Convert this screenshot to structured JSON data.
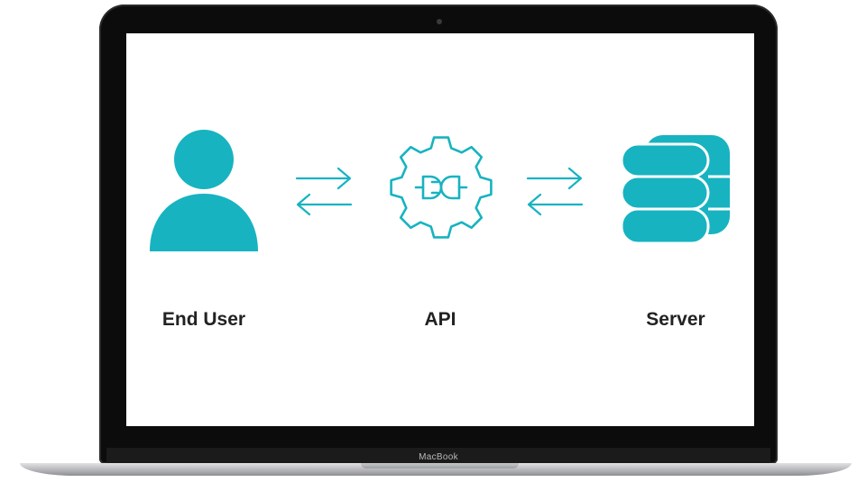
{
  "device": {
    "brand_label": "MacBook"
  },
  "diagram": {
    "accent_color": "#17b3c1",
    "nodes": [
      {
        "id": "end-user",
        "label": "End User",
        "icon": "user-icon"
      },
      {
        "id": "api",
        "label": "API",
        "icon": "gear-plug-icon"
      },
      {
        "id": "server",
        "label": "Server",
        "icon": "database-icon"
      }
    ],
    "connectors": [
      {
        "from": "end-user",
        "to": "api",
        "icon": "bidirectional-arrows-icon"
      },
      {
        "from": "api",
        "to": "server",
        "icon": "bidirectional-arrows-icon"
      }
    ]
  }
}
